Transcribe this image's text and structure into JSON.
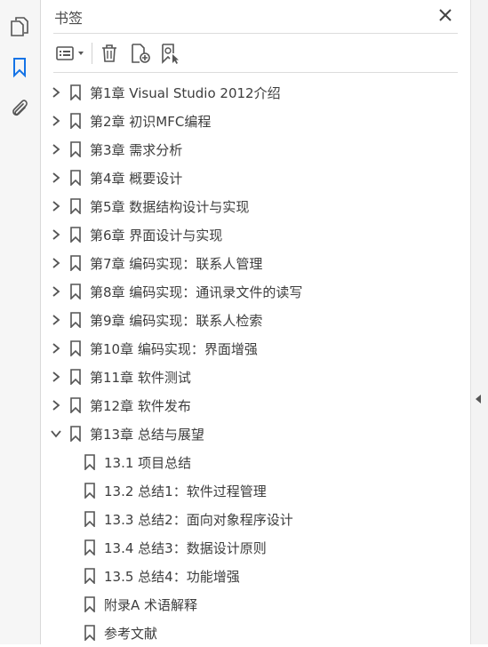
{
  "panel": {
    "title": "书签",
    "icons": {
      "close": "close-icon",
      "options": "list-options-icon",
      "delete": "trash-icon",
      "new_bookmark": "new-bookmark-icon",
      "bookmark_from_selection": "bookmark-select-icon"
    }
  },
  "rail": {
    "icons": [
      "pages-icon",
      "bookmark-icon",
      "attachment-icon"
    ],
    "active_color": "#1473e6"
  },
  "bookmarks": [
    {
      "label": "第1章  Visual Studio 2012介绍",
      "level": 0,
      "expandable": true,
      "expanded": false
    },
    {
      "label": "第2章  初识MFC编程",
      "level": 0,
      "expandable": true,
      "expanded": false
    },
    {
      "label": "第3章  需求分析",
      "level": 0,
      "expandable": true,
      "expanded": false
    },
    {
      "label": "第4章  概要设计",
      "level": 0,
      "expandable": true,
      "expanded": false
    },
    {
      "label": "第5章  数据结构设计与实现",
      "level": 0,
      "expandable": true,
      "expanded": false
    },
    {
      "label": "第6章  界面设计与实现",
      "level": 0,
      "expandable": true,
      "expanded": false
    },
    {
      "label": "第7章  编码实现：联系人管理",
      "level": 0,
      "expandable": true,
      "expanded": false
    },
    {
      "label": "第8章  编码实现：通讯录文件的读写",
      "level": 0,
      "expandable": true,
      "expanded": false
    },
    {
      "label": "第9章  编码实现：联系人检索",
      "level": 0,
      "expandable": true,
      "expanded": false
    },
    {
      "label": "第10章  编码实现：界面增强",
      "level": 0,
      "expandable": true,
      "expanded": false
    },
    {
      "label": "第11章  软件测试",
      "level": 0,
      "expandable": true,
      "expanded": false
    },
    {
      "label": "第12章  软件发布",
      "level": 0,
      "expandable": true,
      "expanded": false
    },
    {
      "label": "第13章  总结与展望",
      "level": 0,
      "expandable": true,
      "expanded": true
    },
    {
      "label": "13.1  项目总结",
      "level": 1,
      "expandable": false,
      "expanded": false
    },
    {
      "label": "13.2  总结1：软件过程管理",
      "level": 1,
      "expandable": false,
      "expanded": false
    },
    {
      "label": "13.3  总结2：面向对象程序设计",
      "level": 1,
      "expandable": false,
      "expanded": false
    },
    {
      "label": "13.4  总结3：数据设计原则",
      "level": 1,
      "expandable": false,
      "expanded": false
    },
    {
      "label": "13.5  总结4：功能增强",
      "level": 1,
      "expandable": false,
      "expanded": false
    },
    {
      "label": "附录A  术语解释",
      "level": 1,
      "expandable": false,
      "expanded": false
    },
    {
      "label": "参考文献",
      "level": 1,
      "expandable": false,
      "expanded": false
    }
  ]
}
